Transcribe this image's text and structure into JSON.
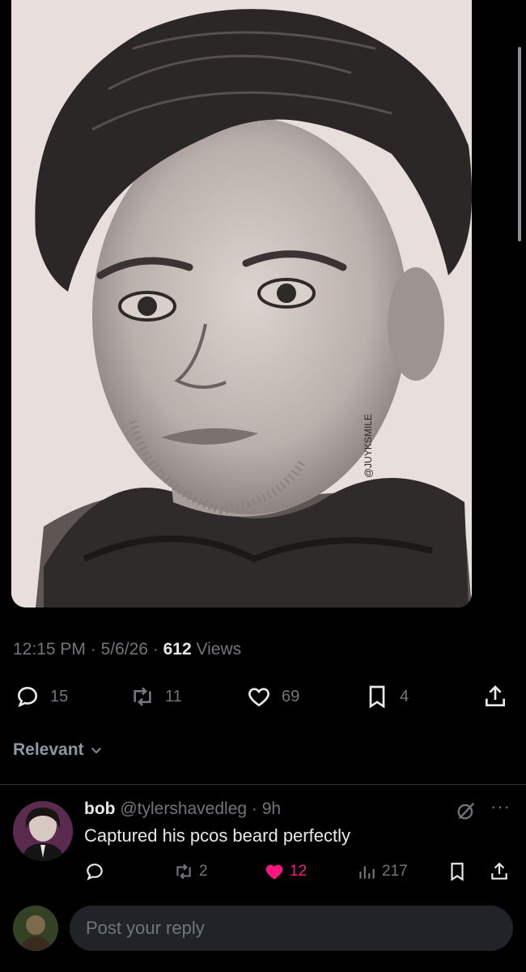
{
  "media": {
    "description": "pencil portrait drawing",
    "watermark": "@JUYKSMILE"
  },
  "tweet": {
    "time": "12:15 PM",
    "date": "5/6/26",
    "separator": " · ",
    "views_count": "612",
    "views_label": "Views"
  },
  "actions": {
    "replies": "15",
    "reposts": "11",
    "likes": "69",
    "bookmarks": "4",
    "icons": [
      "reply-icon",
      "repost-icon",
      "like-icon",
      "bookmark-icon",
      "share-icon"
    ]
  },
  "sort": {
    "label": "Relevant"
  },
  "reply": {
    "name": "bob",
    "handle": "@tylershavedleg",
    "time": "9h",
    "dot": " · ",
    "text": "Captured his pcos beard perfectly",
    "more": "···",
    "reposts": "2",
    "likes": "12",
    "views": "217",
    "like_color": "#f91880"
  },
  "composer": {
    "placeholder": "Post your reply"
  },
  "colors": {
    "background": "#000000",
    "text_primary": "#e7e9ea",
    "text_secondary": "#71767b",
    "divider": "#2f3336",
    "input_bg": "#202327",
    "like_pink": "#f91880"
  }
}
